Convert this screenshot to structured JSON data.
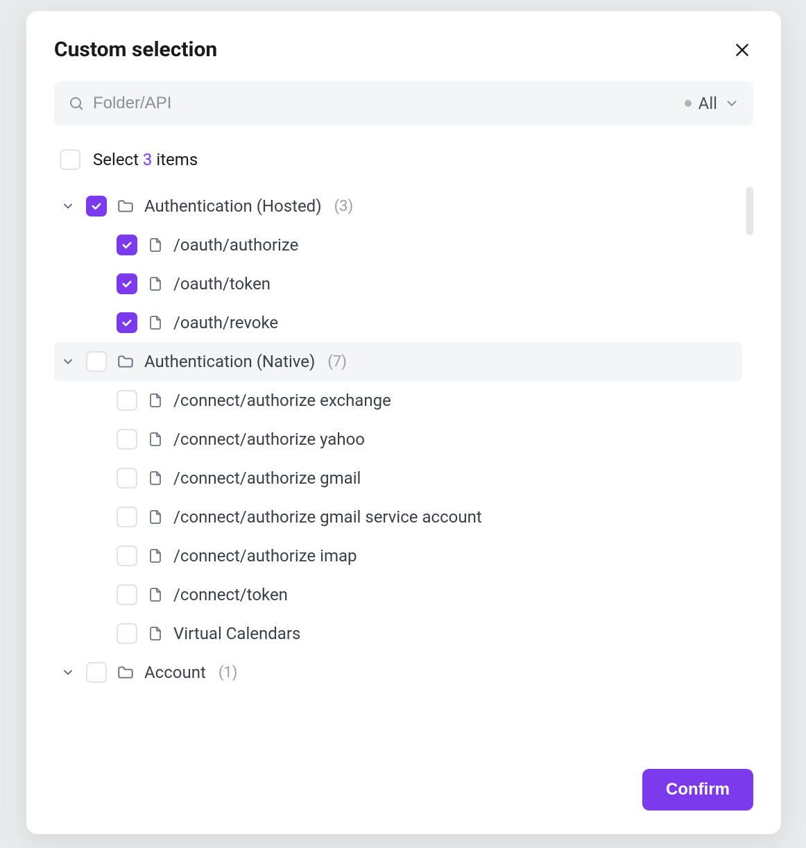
{
  "modal": {
    "title": "Custom selection",
    "search_placeholder": "Folder/API",
    "filter_label": "All",
    "select_prefix": "Select ",
    "select_count": "3",
    "select_suffix": " items",
    "confirm_label": "Confirm"
  },
  "tree": [
    {
      "type": "folder",
      "label": "Authentication (Hosted)",
      "count": "(3)",
      "checked": true,
      "expanded": true,
      "hover": false,
      "items": [
        {
          "label": "/oauth/authorize",
          "checked": true
        },
        {
          "label": "/oauth/token",
          "checked": true
        },
        {
          "label": "/oauth/revoke",
          "checked": true
        }
      ]
    },
    {
      "type": "folder",
      "label": "Authentication (Native)",
      "count": "(7)",
      "checked": false,
      "expanded": true,
      "hover": true,
      "items": [
        {
          "label": "/connect/authorize exchange",
          "checked": false
        },
        {
          "label": "/connect/authorize yahoo",
          "checked": false
        },
        {
          "label": "/connect/authorize gmail",
          "checked": false
        },
        {
          "label": "/connect/authorize gmail service account",
          "checked": false
        },
        {
          "label": "/connect/authorize imap",
          "checked": false
        },
        {
          "label": "/connect/token",
          "checked": false
        },
        {
          "label": "Virtual Calendars",
          "checked": false
        }
      ]
    },
    {
      "type": "folder",
      "label": "Account",
      "count": "(1)",
      "checked": false,
      "expanded": true,
      "hover": false,
      "items": []
    }
  ]
}
